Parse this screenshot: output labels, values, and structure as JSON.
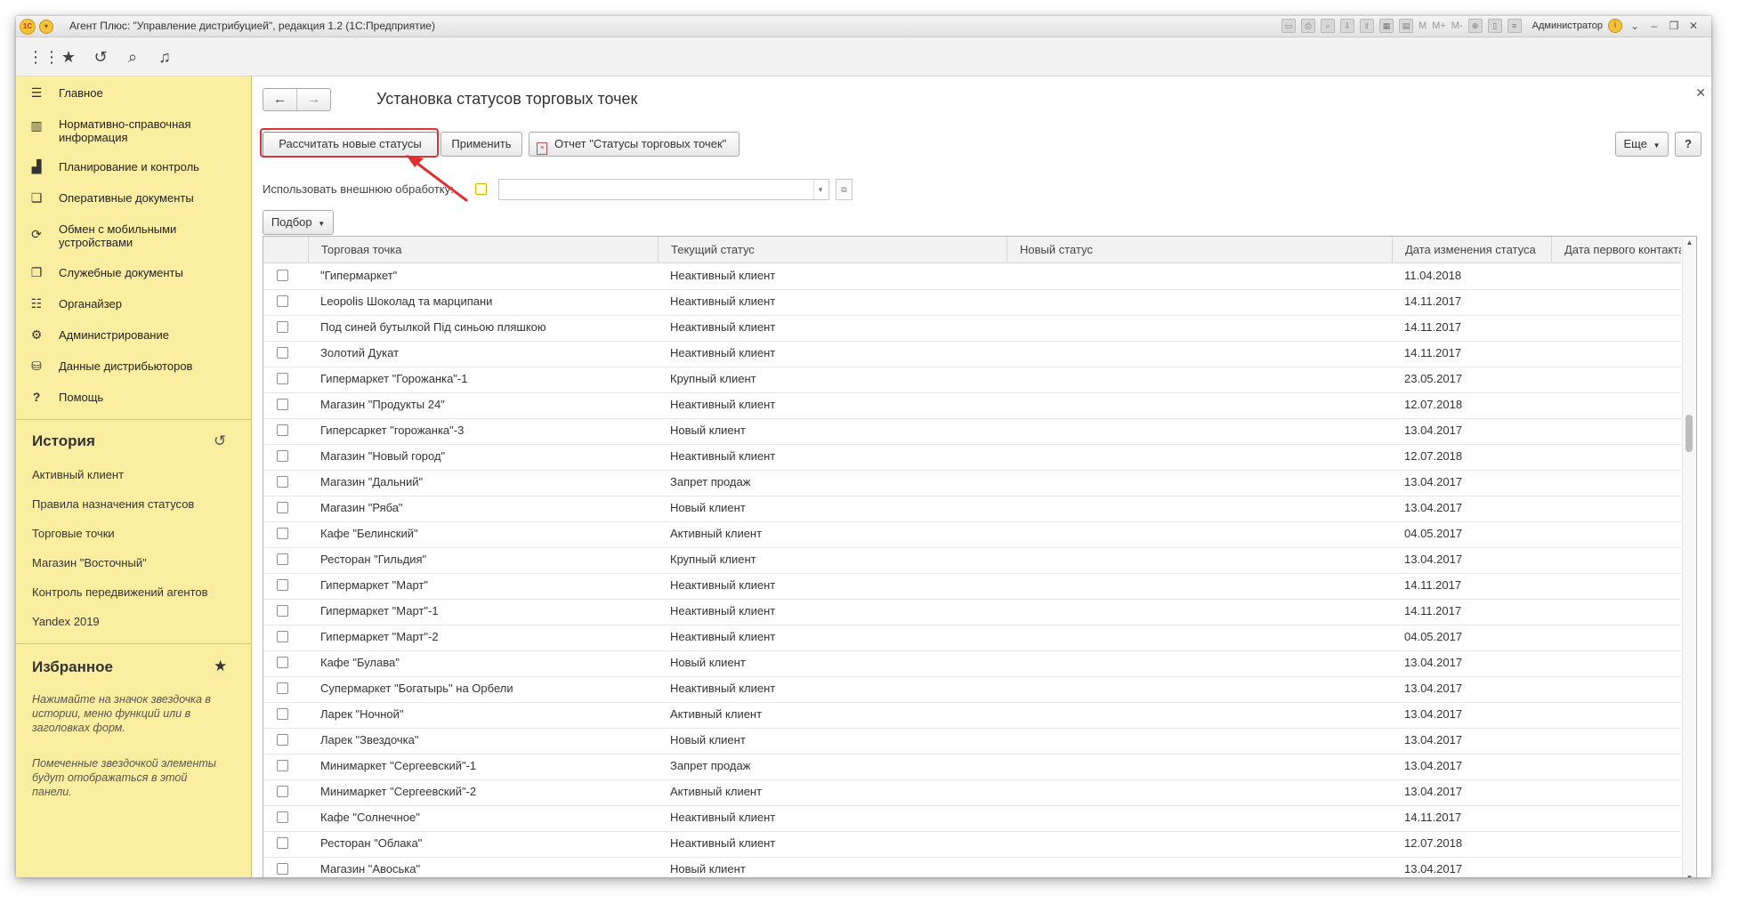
{
  "window": {
    "title": "Агент Плюс: \"Управление дистрибуцией\", редакция 1.2  (1С:Предприятие)",
    "user": "Администратор",
    "tool_m": "M",
    "tool_mplus": "M+",
    "tool_mminus": "M-"
  },
  "toolbar_icons": [
    "apps-grid-icon",
    "star-icon",
    "history-icon",
    "search-icon",
    "bell-icon"
  ],
  "sidebar": {
    "nav": [
      {
        "label": "Главное",
        "icon": "menu-icon"
      },
      {
        "label": "Нормативно-справочная информация",
        "icon": "catalog-icon"
      },
      {
        "label": "Планирование и контроль",
        "icon": "chart-icon"
      },
      {
        "label": "Оперативные документы",
        "icon": "documents-icon"
      },
      {
        "label": "Обмен с мобильными устройствами",
        "icon": "sync-icon"
      },
      {
        "label": "Служебные документы",
        "icon": "service-docs-icon"
      },
      {
        "label": "Органайзер",
        "icon": "organizer-icon"
      },
      {
        "label": "Администрирование",
        "icon": "gear-icon"
      },
      {
        "label": "Данные дистрибьюторов",
        "icon": "distributors-icon"
      },
      {
        "label": "Помощь",
        "icon": "help-icon"
      }
    ],
    "history_title": "История",
    "history": [
      "Активный клиент",
      "Правила назначения статусов",
      "Торговые точки",
      "Магазин \"Восточный\"",
      "Контроль передвижений агентов",
      "Yandex 2019"
    ],
    "favorites_title": "Избранное",
    "favorites_hint_1": "Нажимайте на значок звездочка в истории, меню функций или в заголовках форм.",
    "favorites_hint_2": "Помеченные звездочкой элементы будут отображаться в этой панели."
  },
  "form": {
    "title": "Установка статусов торговых точек",
    "btn_calculate": "Рассчитать новые статусы",
    "btn_apply": "Применить",
    "btn_report": "Отчет \"Статусы торговых точек\"",
    "btn_more": "Еще",
    "btn_help": "?",
    "external_label": "Использовать внешнюю обработку:",
    "external_value": "",
    "btn_selection": "Подбор"
  },
  "table": {
    "columns": [
      "Торговая точка",
      "Текущий статус",
      "Новый статус",
      "Дата изменения статуса",
      "Дата первого контакта"
    ],
    "rows": [
      {
        "point": "\"Гипермаркет\"",
        "status": "Неактивный клиент",
        "new": "",
        "changed": "11.04.2018",
        "first": ""
      },
      {
        "point": "Leopolis Шоколад та марципани",
        "status": "Неактивный клиент",
        "new": "",
        "changed": "14.11.2017",
        "first": ""
      },
      {
        "point": "Под синей бутылкой Під синьою пляшкою",
        "status": "Неактивный клиент",
        "new": "",
        "changed": "14.11.2017",
        "first": ""
      },
      {
        "point": "Золотий Дукат",
        "status": "Неактивный клиент",
        "new": "",
        "changed": "14.11.2017",
        "first": ""
      },
      {
        "point": "Гипермаркет \"Горожанка\"-1",
        "status": "Крупный клиент",
        "new": "",
        "changed": "23.05.2017",
        "first": ""
      },
      {
        "point": "Магазин \"Продукты 24\"",
        "status": "Неактивный клиент",
        "new": "",
        "changed": "12.07.2018",
        "first": ""
      },
      {
        "point": "Гиперсаркет \"горожанка\"-3",
        "status": "Новый клиент",
        "new": "",
        "changed": "13.04.2017",
        "first": ""
      },
      {
        "point": "Магазин \"Новый город\"",
        "status": "Неактивный клиент",
        "new": "",
        "changed": "12.07.2018",
        "first": ""
      },
      {
        "point": "Магазин \"Дальний\"",
        "status": "Запрет продаж",
        "new": "",
        "changed": "13.04.2017",
        "first": ""
      },
      {
        "point": "Магазин \"Ряба\"",
        "status": "Новый клиент",
        "new": "",
        "changed": "13.04.2017",
        "first": ""
      },
      {
        "point": "Кафе \"Белинский\"",
        "status": "Активный клиент",
        "new": "",
        "changed": "04.05.2017",
        "first": ""
      },
      {
        "point": "Ресторан \"Гильдия\"",
        "status": "Крупный клиент",
        "new": "",
        "changed": "13.04.2017",
        "first": ""
      },
      {
        "point": "Гипермаркет \"Март\"",
        "status": "Неактивный клиент",
        "new": "",
        "changed": "14.11.2017",
        "first": ""
      },
      {
        "point": "Гипермаркет \"Март\"-1",
        "status": "Неактивный клиент",
        "new": "",
        "changed": "14.11.2017",
        "first": ""
      },
      {
        "point": "Гипермаркет \"Март\"-2",
        "status": "Неактивный клиент",
        "new": "",
        "changed": "04.05.2017",
        "first": ""
      },
      {
        "point": "Кафе \"Булава\"",
        "status": "Новый клиент",
        "new": "",
        "changed": "13.04.2017",
        "first": ""
      },
      {
        "point": "Супермаркет \"Богатырь\" на Орбели",
        "status": "Неактивный клиент",
        "new": "",
        "changed": "13.04.2017",
        "first": ""
      },
      {
        "point": "Ларек \"Ночной\"",
        "status": "Активный клиент",
        "new": "",
        "changed": "13.04.2017",
        "first": ""
      },
      {
        "point": "Ларек \"Звездочка\"",
        "status": "Новый клиент",
        "new": "",
        "changed": "13.04.2017",
        "first": ""
      },
      {
        "point": "Минимаркет \"Сергеевский\"-1",
        "status": "Запрет продаж",
        "new": "",
        "changed": "13.04.2017",
        "first": ""
      },
      {
        "point": "Минимаркет \"Сергеевский\"-2",
        "status": "Активный клиент",
        "new": "",
        "changed": "13.04.2017",
        "first": ""
      },
      {
        "point": "Кафе \"Солнечное\"",
        "status": "Неактивный клиент",
        "new": "",
        "changed": "14.11.2017",
        "first": ""
      },
      {
        "point": "Ресторан \"Облака\"",
        "status": "Неактивный клиент",
        "new": "",
        "changed": "12.07.2018",
        "first": ""
      },
      {
        "point": "Магазин \"Авоська\"",
        "status": "Новый клиент",
        "new": "",
        "changed": "13.04.2017",
        "first": ""
      }
    ]
  },
  "colors": {
    "sidebar_bg": "#fbeea0",
    "annotation_red": "#e03030",
    "brand_yellow": "#f5c33a"
  }
}
